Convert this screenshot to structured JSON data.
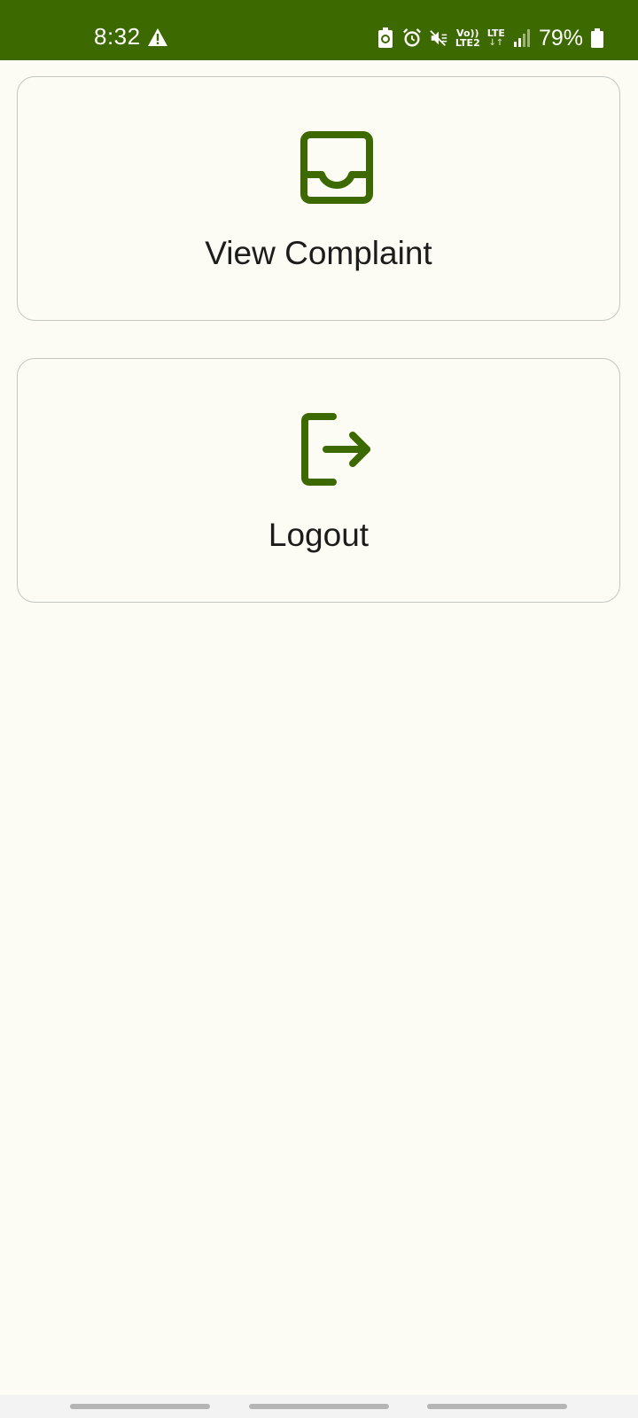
{
  "status_bar": {
    "time": "8:32",
    "battery_percent": "79%",
    "network_top": "Vo))",
    "network_bottom": "LTE2",
    "lte_label": "LTE",
    "background_color": "#3d6a00",
    "icons": [
      "warning-icon",
      "battery-saver-icon",
      "alarm-icon",
      "mute-icon",
      "volte-icon",
      "lte-icon",
      "signal-icon",
      "battery-icon"
    ]
  },
  "menu": {
    "items": [
      {
        "label": "View Complaint",
        "icon": "inbox-tray-icon"
      },
      {
        "label": "Logout",
        "icon": "logout-icon"
      }
    ],
    "accent_color": "#3d6a00"
  }
}
